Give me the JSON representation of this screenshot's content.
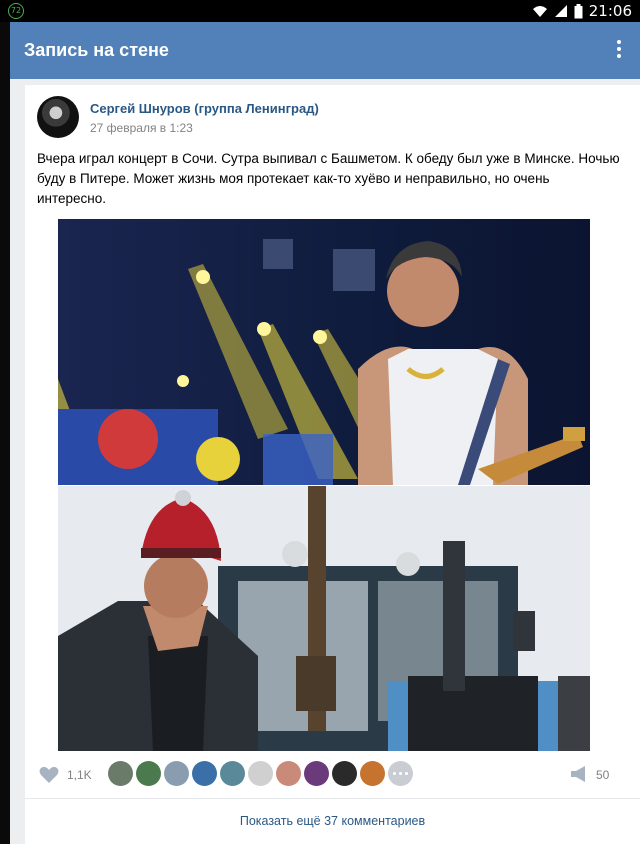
{
  "status_bar": {
    "notification": "72",
    "time": "21:06"
  },
  "app_bar": {
    "title": "Запись на стене",
    "menu_icon": "more-vertical-icon"
  },
  "post": {
    "author": "Сергей Шнуров (группа Ленинград)",
    "date": "27 февраля в 1:23",
    "text": "Вчера играл концерт в Сочи. Сутра выпивал с Башметом. К обеду был уже в Минске. Ночью буду в Питере. Может жизнь моя протекает как-то хуёво и неправильно, но очень интересно.",
    "photos": [
      {
        "description_icon": "concert-photo"
      },
      {
        "description_icon": "tractor-photo"
      }
    ],
    "likes": "1,1K",
    "shares": "50",
    "liker_colors": [
      "#6b7b6a",
      "#4a7a4e",
      "#8a9db0",
      "#3b6fa8",
      "#5a8a9a",
      "#d0d0d0",
      "#c98a7a",
      "#6a3a7a",
      "#2a2a2a",
      "#c5732e"
    ],
    "show_more": "Показать ещё 37 комментариев"
  },
  "colors": {
    "accent": "#5181b8",
    "link": "#2a5885",
    "muted": "#828282",
    "background": "#edeef0"
  }
}
